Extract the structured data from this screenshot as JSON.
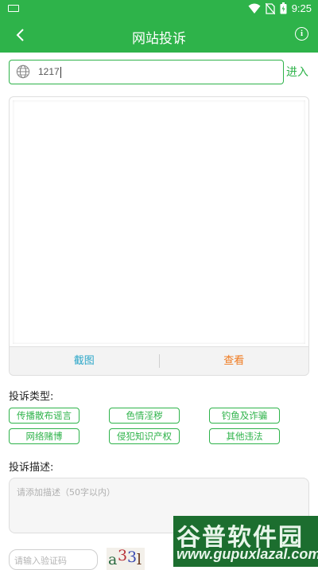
{
  "status_bar": {
    "time": "9:25",
    "icons": [
      "keyboard-icon",
      "wifi-icon",
      "no-sim-icon",
      "battery-icon"
    ]
  },
  "app_bar": {
    "title": "网站投诉",
    "back_icon": "back-arrow-icon",
    "info_icon": "info-icon",
    "info_glyph": "i"
  },
  "url_bar": {
    "value": "1217",
    "icon": "globe-icon",
    "enter_label": "进入"
  },
  "preview": {
    "screenshot_label": "截图",
    "view_label": "查看"
  },
  "complaint_type": {
    "label": "投诉类型:",
    "options": [
      "传播散布谣言",
      "色情淫秽",
      "钓鱼及诈骗",
      "网络赌博",
      "侵犯知识产权",
      "其他违法"
    ]
  },
  "complaint_desc": {
    "label": "投诉描述:",
    "placeholder": "请添加描述（50字以内）"
  },
  "captcha": {
    "placeholder": "请输入验证码",
    "chars": [
      "a",
      "3",
      "3",
      "l"
    ]
  },
  "watermark": {
    "line1": "谷普软件园",
    "line2": "www.gupuxlazal.com"
  },
  "colors": {
    "primary": "#2eb34a",
    "screenshot": "#2aa6c8",
    "view": "#f07a1e"
  }
}
